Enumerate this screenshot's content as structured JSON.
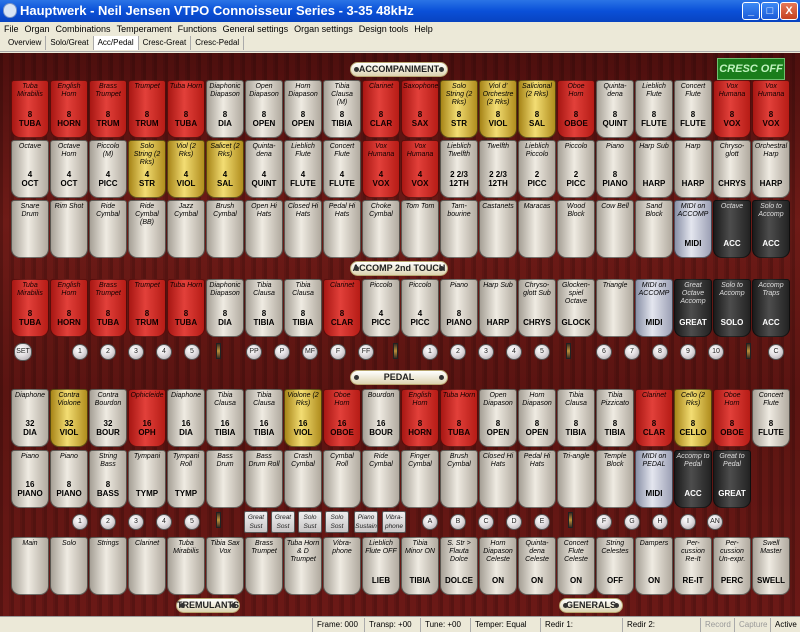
{
  "window": {
    "title": "Hauptwerk - Neil Jensen VTPO Connoisseur Series - 3-35 48kHz",
    "min": "_",
    "max": "□",
    "close": "X"
  },
  "menu": [
    "File",
    "Organ",
    "Combinations",
    "Temperament",
    "Functions",
    "General settings",
    "Organ settings",
    "Design tools",
    "Help"
  ],
  "tabs": [
    "Overview",
    "Solo/Great",
    "Acc/Pedal",
    "Cresc-Great",
    "Cresc-Pedal"
  ],
  "active_tab": 2,
  "cresc_off": "CRESC OFF",
  "sections": {
    "accompaniment": "ACCOMPANIMENT",
    "accomp2": "ACCOMP 2nd TOUCH",
    "pedal": "PEDAL",
    "tremulants": "TREMULANTS",
    "generals": "GENERALS"
  },
  "rows": [
    [
      {
        "n": "Tuba Mirabilis",
        "l": "8\nTUBA",
        "c": "red"
      },
      {
        "n": "English Horn",
        "l": "8\nHORN",
        "c": "red"
      },
      {
        "n": "Brass Trumpet",
        "l": "8\nTRUM",
        "c": "red"
      },
      {
        "n": "Trumpet",
        "l": "8\nTRUM",
        "c": "red"
      },
      {
        "n": "Tuba Horn",
        "l": "8\nTUBA",
        "c": "red"
      },
      {
        "n": "Diaphonic Diapason",
        "l": "8\nDIA",
        "c": "white"
      },
      {
        "n": "Open Diapason",
        "l": "8\nOPEN",
        "c": "white"
      },
      {
        "n": "Horn Diapason",
        "l": "8\nOPEN",
        "c": "white"
      },
      {
        "n": "Tibia Clausa (M)",
        "l": "8\nTIBIA",
        "c": "white"
      },
      {
        "n": "Clarinet",
        "l": "8\nCLAR",
        "c": "red"
      },
      {
        "n": "Saxophone",
        "l": "8\nSAX",
        "c": "red"
      },
      {
        "n": "Solo String (2 Rks)",
        "l": "8\nSTR",
        "c": "gold"
      },
      {
        "n": "Viol d' Orchestre (2 Rks)",
        "l": "8\nVIOL",
        "c": "gold"
      },
      {
        "n": "Salicional (2 Rks)",
        "l": "8\nSAL",
        "c": "gold"
      },
      {
        "n": "Oboe Horn",
        "l": "8\nOBOE",
        "c": "red"
      },
      {
        "n": "Quinta-dena",
        "l": "8\nQUINT",
        "c": "white"
      },
      {
        "n": "Lieblich Flute",
        "l": "8\nFLUTE",
        "c": "white"
      },
      {
        "n": "Concert Flute",
        "l": "8\nFLUTE",
        "c": "white"
      },
      {
        "n": "Vox Humana",
        "l": "8\nVOX",
        "c": "red"
      },
      {
        "n": "Vox Humana",
        "l": "8\nVOX",
        "c": "red"
      }
    ],
    [
      {
        "n": "Octave",
        "l": "4\nOCT",
        "c": "white"
      },
      {
        "n": "Octave Horn",
        "l": "4\nOCT",
        "c": "white"
      },
      {
        "n": "Piccolo (M)",
        "l": "4\nPICC",
        "c": "white"
      },
      {
        "n": "Solo String (2 Rks)",
        "l": "4\nSTR",
        "c": "gold"
      },
      {
        "n": "Viol (2 Rks)",
        "l": "4\nVIOL",
        "c": "gold"
      },
      {
        "n": "Salicet (2 Rks)",
        "l": "4\nSAL",
        "c": "gold"
      },
      {
        "n": "Quinta-dena",
        "l": "4\nQUINT",
        "c": "white"
      },
      {
        "n": "Lieblich Flute",
        "l": "4\nFLUTE",
        "c": "white"
      },
      {
        "n": "Concert Flute",
        "l": "4\nFLUTE",
        "c": "white"
      },
      {
        "n": "Vox Humana",
        "l": "4\nVOX",
        "c": "red"
      },
      {
        "n": "Vox Humana",
        "l": "4\nVOX",
        "c": "red"
      },
      {
        "n": "Lieblich Twelfth",
        "l": "2 2/3\n12TH",
        "c": "white"
      },
      {
        "n": "Twelfth",
        "l": "2 2/3\n12TH",
        "c": "white"
      },
      {
        "n": "Lieblich Piccolo",
        "l": "2\nPICC",
        "c": "white"
      },
      {
        "n": "Piccolo",
        "l": "2\nPICC",
        "c": "white"
      },
      {
        "n": "Piano",
        "l": "8\nPIANO",
        "c": "white"
      },
      {
        "n": "Harp Sub",
        "l": "HARP",
        "c": "white"
      },
      {
        "n": "Harp",
        "l": "HARP",
        "c": "white"
      },
      {
        "n": "Chryso-glott",
        "l": "CHRYS",
        "c": "white"
      },
      {
        "n": "Orchestral Harp",
        "l": "HARP",
        "c": "white"
      }
    ],
    [
      {
        "n": "Snare Drum",
        "l": "",
        "c": "white"
      },
      {
        "n": "Rim Shot",
        "l": "",
        "c": "white"
      },
      {
        "n": "Ride Cymbal",
        "l": "",
        "c": "white"
      },
      {
        "n": "Ride Cymbal (BB)",
        "l": "",
        "c": "white"
      },
      {
        "n": "Jazz Cymbal",
        "l": "",
        "c": "white"
      },
      {
        "n": "Brush Cymbal",
        "l": "",
        "c": "white"
      },
      {
        "n": "Open Hi Hats",
        "l": "",
        "c": "white"
      },
      {
        "n": "Closed Hi Hats",
        "l": "",
        "c": "white"
      },
      {
        "n": "Pedal Hi Hats",
        "l": "",
        "c": "white"
      },
      {
        "n": "Choke Cymbal",
        "l": "",
        "c": "white"
      },
      {
        "n": "Tom Tom",
        "l": "",
        "c": "white"
      },
      {
        "n": "Tam-bourine",
        "l": "",
        "c": "white"
      },
      {
        "n": "Castanets",
        "l": "",
        "c": "white"
      },
      {
        "n": "Maracas",
        "l": "",
        "c": "white"
      },
      {
        "n": "Wood Block",
        "l": "",
        "c": "white"
      },
      {
        "n": "Cow Bell",
        "l": "",
        "c": "white"
      },
      {
        "n": "Sand Block",
        "l": "",
        "c": "white"
      },
      {
        "n": "MIDI on ACCOMP",
        "l": "MIDI",
        "c": "gray"
      },
      {
        "n": "Octave",
        "l": "ACC",
        "c": "black"
      },
      {
        "n": "Solo to Accomp",
        "l": "ACC",
        "c": "black"
      }
    ],
    [
      {
        "n": "Tuba Mirabilis",
        "l": "8\nTUBA",
        "c": "red"
      },
      {
        "n": "English Horn",
        "l": "8\nHORN",
        "c": "red"
      },
      {
        "n": "Brass Trumpet",
        "l": "8\nTUBA",
        "c": "red"
      },
      {
        "n": "Trumpet",
        "l": "8\nTRUM",
        "c": "red"
      },
      {
        "n": "Tuba Horn",
        "l": "8\nTUBA",
        "c": "red"
      },
      {
        "n": "Diaphonic Diapason",
        "l": "8\nDIA",
        "c": "white"
      },
      {
        "n": "Tibia Clausa",
        "l": "8\nTIBIA",
        "c": "white"
      },
      {
        "n": "Tibia Clausa",
        "l": "8\nTIBIA",
        "c": "white"
      },
      {
        "n": "Clarinet",
        "l": "8\nCLAR",
        "c": "red"
      },
      {
        "n": "Piccolo",
        "l": "4\nPICC",
        "c": "white"
      },
      {
        "n": "Piccolo",
        "l": "4\nPICC",
        "c": "white"
      },
      {
        "n": "Piano",
        "l": "8\nPIANO",
        "c": "white"
      },
      {
        "n": "Harp Sub",
        "l": "HARP",
        "c": "white"
      },
      {
        "n": "Chryso-glott Sub",
        "l": "CHRYS",
        "c": "white"
      },
      {
        "n": "Glocken-spiel Octave",
        "l": "GLOCK",
        "c": "white"
      },
      {
        "n": "Triangle",
        "l": "",
        "c": "white"
      },
      {
        "n": "MIDI on ACCOMP",
        "l": "MIDI",
        "c": "gray"
      },
      {
        "n": "Great Octave Accomp",
        "l": "GREAT",
        "c": "black"
      },
      {
        "n": "Solo to Accomp",
        "l": "SOLO",
        "c": "black"
      },
      {
        "n": "Accomp Traps",
        "l": "ACC",
        "c": "black"
      }
    ],
    [
      {
        "n": "Diaphone",
        "l": "32\nDIA",
        "c": "white"
      },
      {
        "n": "Contra Violone",
        "l": "32\nVIOL",
        "c": "gold"
      },
      {
        "n": "Contra Bourdon",
        "l": "32\nBOUR",
        "c": "white"
      },
      {
        "n": "Ophicleide",
        "l": "16\nOPH",
        "c": "red"
      },
      {
        "n": "Diaphone",
        "l": "16\nDIA",
        "c": "white"
      },
      {
        "n": "Tibia Clausa",
        "l": "16\nTIBIA",
        "c": "white"
      },
      {
        "n": "Tibia Clausa",
        "l": "16\nTIBIA",
        "c": "white"
      },
      {
        "n": "Violone (2 Rks)",
        "l": "16\nVIOL",
        "c": "gold"
      },
      {
        "n": "Oboe Horn",
        "l": "16\nOBOE",
        "c": "red"
      },
      {
        "n": "Bourdon",
        "l": "16\nBOUR",
        "c": "white"
      },
      {
        "n": "English Horn",
        "l": "8\nHORN",
        "c": "red"
      },
      {
        "n": "Tuba Horn",
        "l": "8\nTUBA",
        "c": "red"
      },
      {
        "n": "Open Diapason",
        "l": "8\nOPEN",
        "c": "white"
      },
      {
        "n": "Horn Diapason",
        "l": "8\nOPEN",
        "c": "white"
      },
      {
        "n": "Tibia Clausa",
        "l": "8\nTIBIA",
        "c": "white"
      },
      {
        "n": "Tibia Pizzicato",
        "l": "8\nTIBIA",
        "c": "white"
      },
      {
        "n": "Clarinet",
        "l": "8\nCLAR",
        "c": "red"
      },
      {
        "n": "Cello (2 Rks)",
        "l": "8\nCELLO",
        "c": "gold"
      },
      {
        "n": "Oboe Horn",
        "l": "8\nOBOE",
        "c": "red"
      },
      {
        "n": "Concert Flute",
        "l": "8\nFLUTE",
        "c": "white"
      }
    ],
    [
      {
        "n": "Piano",
        "l": "16\nPIANO",
        "c": "white"
      },
      {
        "n": "Piano",
        "l": "8\nPIANO",
        "c": "white"
      },
      {
        "n": "String Bass",
        "l": "8\nBASS",
        "c": "white"
      },
      {
        "n": "Tympani",
        "l": "TYMP",
        "c": "white"
      },
      {
        "n": "Tympani Roll",
        "l": "TYMP",
        "c": "white"
      },
      {
        "n": "Bass Drum",
        "l": "",
        "c": "white"
      },
      {
        "n": "Bass Drum Roll",
        "l": "",
        "c": "white"
      },
      {
        "n": "Crash Cymbal",
        "l": "",
        "c": "white"
      },
      {
        "n": "Cymbal Roll",
        "l": "",
        "c": "white"
      },
      {
        "n": "Ride Cymbal",
        "l": "",
        "c": "white"
      },
      {
        "n": "Finger Cymbal",
        "l": "",
        "c": "white"
      },
      {
        "n": "Brush Cymbal",
        "l": "",
        "c": "white"
      },
      {
        "n": "Closed Hi Hats",
        "l": "",
        "c": "white"
      },
      {
        "n": "Pedal Hi Hats",
        "l": "",
        "c": "white"
      },
      {
        "n": "Tri-angle",
        "l": "",
        "c": "white"
      },
      {
        "n": "Temple Block",
        "l": "",
        "c": "white"
      },
      {
        "n": "MIDI on PEDAL",
        "l": "MIDI",
        "c": "gray"
      },
      {
        "n": "Accomp to Pedal",
        "l": "ACC",
        "c": "black"
      },
      {
        "n": "Great to Pedal",
        "l": "GREAT",
        "c": "black"
      }
    ],
    [
      {
        "n": "Main",
        "l": "",
        "c": "white"
      },
      {
        "n": "Solo",
        "l": "",
        "c": "white"
      },
      {
        "n": "Strings",
        "l": "",
        "c": "white"
      },
      {
        "n": "Clarinet",
        "l": "",
        "c": "white"
      },
      {
        "n": "Tuba Mirabilis",
        "l": "",
        "c": "white"
      },
      {
        "n": "Tibia Sax Vox",
        "l": "",
        "c": "white"
      },
      {
        "n": "Brass Trumpet",
        "l": "",
        "c": "white"
      },
      {
        "n": "Tuba Horn & D Trumpet",
        "l": "",
        "c": "white"
      },
      {
        "n": "Vibra-phone",
        "l": "",
        "c": "white"
      },
      {
        "n": "Lieblich Flute OFF",
        "l": "LIEB",
        "c": "white"
      },
      {
        "n": "Tibia Minor ON",
        "l": "TIBIA",
        "c": "white"
      },
      {
        "n": "S. Str > Flauta Dolce",
        "l": "DOLCE",
        "c": "white"
      },
      {
        "n": "Horn Diapason Celeste",
        "l": "ON",
        "c": "white"
      },
      {
        "n": "Quinta-dena Celeste",
        "l": "ON",
        "c": "white"
      },
      {
        "n": "Concert Flute Celeste",
        "l": "ON",
        "c": "white"
      },
      {
        "n": "String Celestes",
        "l": "OFF",
        "c": "white"
      },
      {
        "n": "Dampers",
        "l": "ON",
        "c": "white"
      },
      {
        "n": "Per-cussion Re-It",
        "l": "RE-IT",
        "c": "white"
      },
      {
        "n": "Per-cussion Un-expr.",
        "l": "PERC",
        "c": "white"
      },
      {
        "n": "Swell Master",
        "l": "SWELL",
        "c": "white"
      }
    ]
  ],
  "pistons1": [
    "SET",
    "1",
    "2",
    "3",
    "4",
    "5",
    "PP",
    "P",
    "MF",
    "F",
    "FF",
    "1",
    "2",
    "3",
    "4",
    "5",
    "6",
    "7",
    "8",
    "9",
    "10",
    "C"
  ],
  "pistons2": [
    "1",
    "2",
    "3",
    "4",
    "5",
    "A",
    "B",
    "C",
    "D",
    "E",
    "F",
    "G",
    "H",
    "I",
    "AN"
  ],
  "sust": [
    "Great Sust",
    "Great Sost",
    "Solo Sust",
    "Solo Sost",
    "Piano Sustain",
    "Vibra-phone"
  ],
  "status": {
    "frame": "Frame: 000",
    "transp": "Transp: +00",
    "tune": "Tune: +00",
    "temper": "Temper: Equal",
    "redir1": "Redir 1:",
    "redir2": "Redir 2:",
    "record": "Record",
    "capture": "Capture",
    "active": "Active"
  }
}
